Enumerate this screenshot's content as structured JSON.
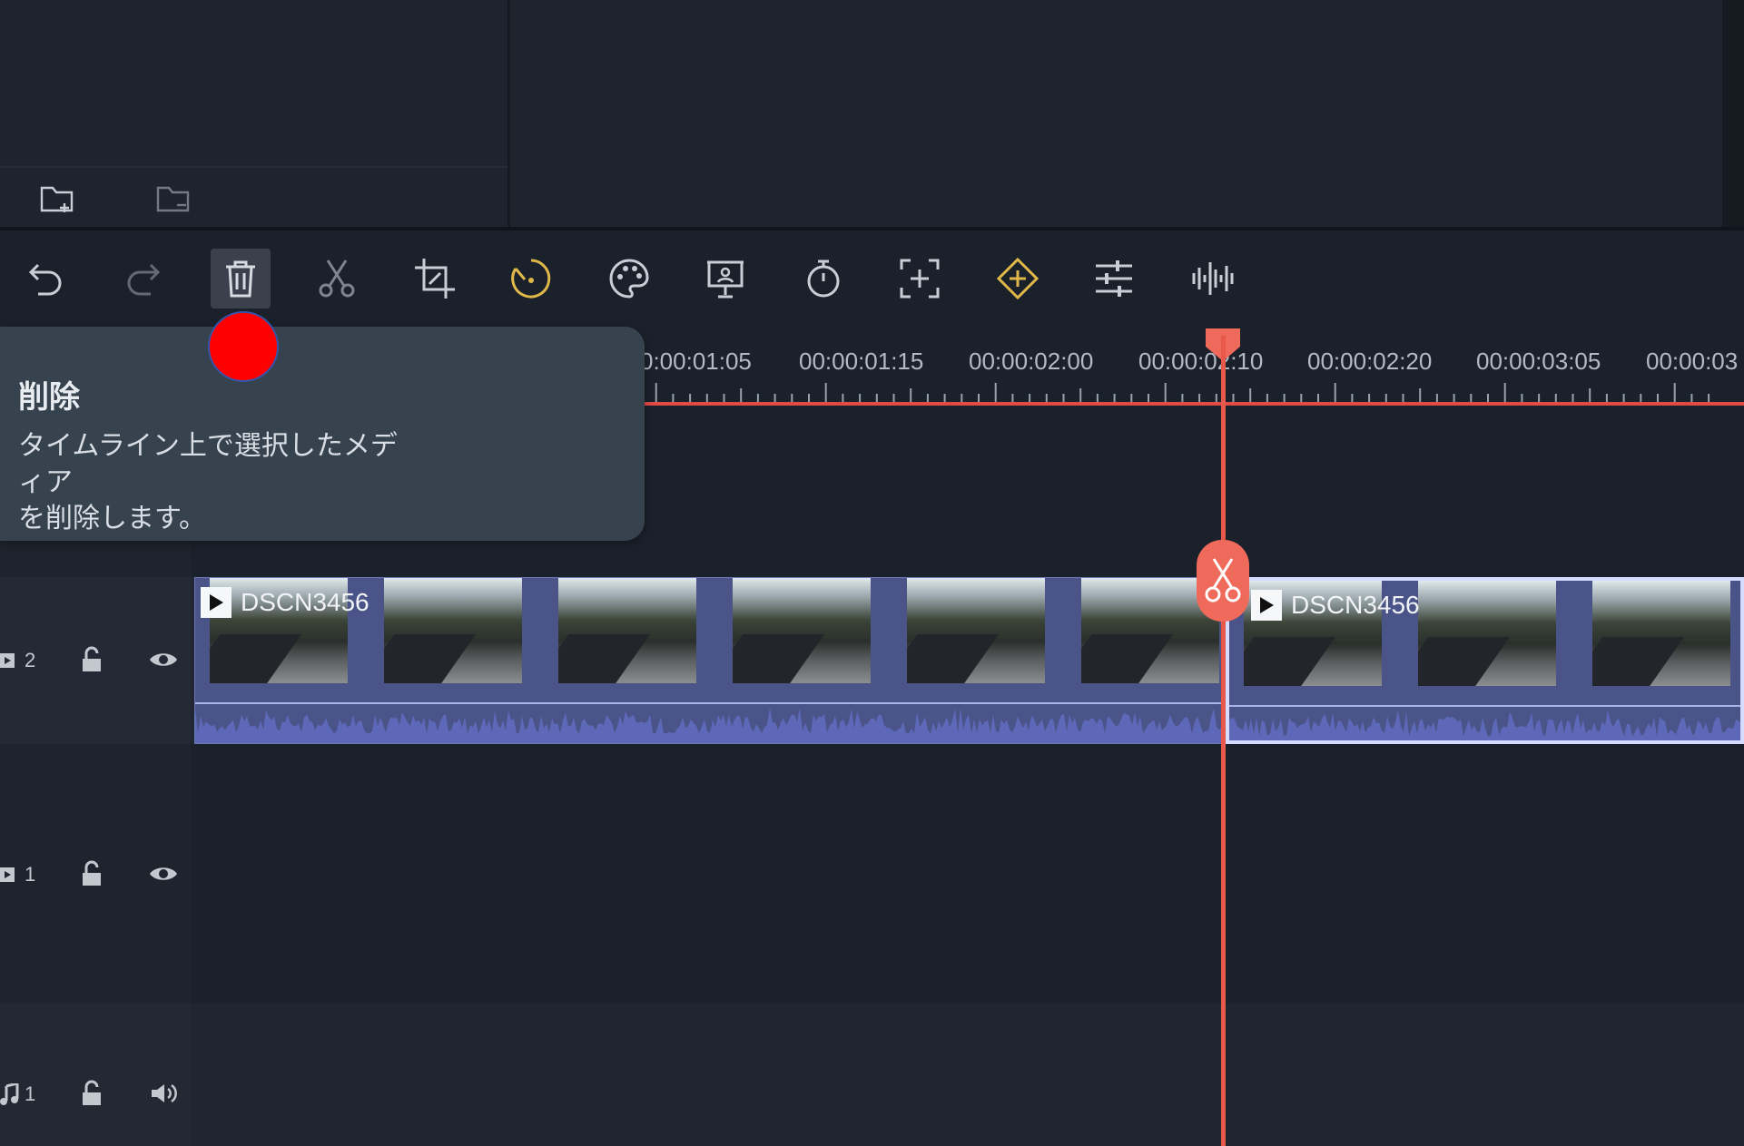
{
  "top_panel": {
    "new_folder_label": "new folder",
    "folder_label": "folder"
  },
  "toolbar": {
    "tools": [
      {
        "name": "undo",
        "icon": "undo-icon"
      },
      {
        "name": "redo",
        "icon": "redo-icon"
      },
      {
        "name": "delete",
        "icon": "trash-icon",
        "active": true
      },
      {
        "name": "cut",
        "icon": "scissors-icon"
      },
      {
        "name": "crop",
        "icon": "crop-icon"
      },
      {
        "name": "speed",
        "icon": "speed-icon"
      },
      {
        "name": "color",
        "icon": "palette-icon"
      },
      {
        "name": "presentation",
        "icon": "presentation-icon"
      },
      {
        "name": "duration",
        "icon": "timer-icon"
      },
      {
        "name": "zoom-fit",
        "icon": "expand-icon"
      },
      {
        "name": "keyframe",
        "icon": "keyframe-icon"
      },
      {
        "name": "adjust",
        "icon": "sliders-icon"
      },
      {
        "name": "audio",
        "icon": "waveform-icon"
      }
    ]
  },
  "tooltip": {
    "title": "削除",
    "description_line1": "タイムライン上で選択したメディア",
    "description_line2": "を削除します。"
  },
  "ruler": {
    "timecodes": [
      "0:00:01:05",
      "00:00:01:15",
      "00:00:02:00",
      "00:00:02:10",
      "00:00:02:20",
      "00:00:03:05",
      "00:00:03"
    ]
  },
  "tracks": {
    "video2": {
      "number": "2",
      "lock_icon": "lock-open-icon",
      "visibility_icon": "eye-icon"
    },
    "video1": {
      "number": "1",
      "lock_icon": "lock-open-icon",
      "visibility_icon": "eye-icon"
    },
    "audio1": {
      "number": "1",
      "lock_icon": "lock-open-icon",
      "volume_icon": "speaker-icon"
    }
  },
  "clips": [
    {
      "name": "DSCN3456",
      "selected": false
    },
    {
      "name": "DSCN3456",
      "selected": true
    }
  ],
  "colors": {
    "playhead": "#e8594c",
    "ruler_line": "#e24a45",
    "clip_fill": "#4a5488",
    "speed_icon": "#e0b84a",
    "keyframe_icon": "#e0b84a",
    "highlight_dot": "#ff0000"
  }
}
